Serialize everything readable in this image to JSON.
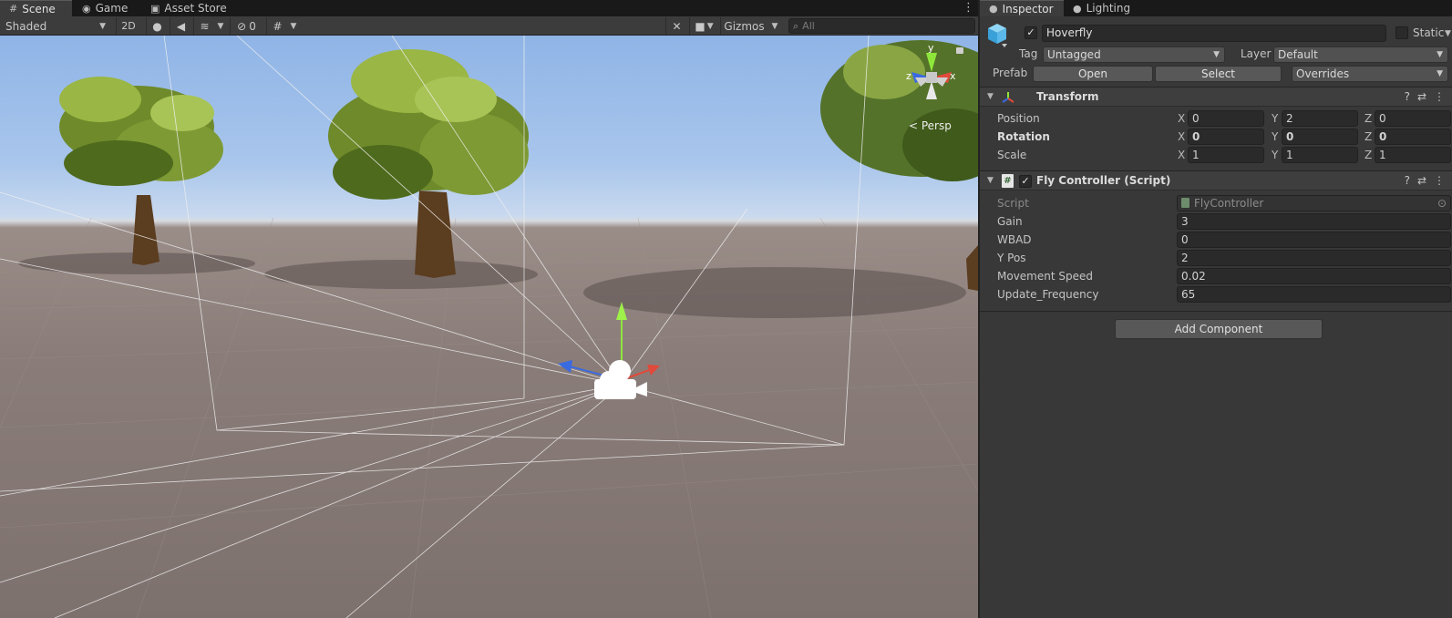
{
  "scene_tabs": [
    {
      "label": "Scene",
      "icon": "grid-icon",
      "active": true
    },
    {
      "label": "Game",
      "icon": "gamepad-icon",
      "active": false
    },
    {
      "label": "Asset Store",
      "icon": "store-bag-icon",
      "active": false
    }
  ],
  "toolbar": {
    "shading_mode": "Shaded",
    "mode_2d": "2D",
    "hidden_count": "0",
    "gizmos_label": "Gizmos",
    "search_placeholder": "All"
  },
  "viewport": {
    "axis_y": "y",
    "axis_x": "x",
    "axis_z": "z",
    "projection_label": "< Persp",
    "colors": {
      "sky_top": "#8fb4e6",
      "ground": "#8a7d79",
      "frustum_lines": "#e6e6e6",
      "axis_x": "#e04a3a",
      "axis_y": "#8ee63a",
      "axis_z": "#3a6ae0"
    }
  },
  "inspector_tabs": [
    {
      "label": "Inspector",
      "icon": "info-icon",
      "active": true
    },
    {
      "label": "Lighting",
      "icon": "lightbulb-icon",
      "active": false
    }
  ],
  "object": {
    "name": "Hoverfly",
    "active": true,
    "static_label": "Static",
    "static_checked": false,
    "tag_label": "Tag",
    "tag_value": "Untagged",
    "layer_label": "Layer",
    "layer_value": "Default",
    "prefab_label": "Prefab",
    "open_label": "Open",
    "select_label": "Select",
    "overrides_label": "Overrides"
  },
  "transform": {
    "title": "Transform",
    "rows": [
      {
        "label": "Position",
        "x": "0",
        "y": "2",
        "z": "0",
        "bold": false
      },
      {
        "label": "Rotation",
        "x": "0",
        "y": "0",
        "z": "0",
        "bold": true
      },
      {
        "label": "Scale",
        "x": "1",
        "y": "1",
        "z": "1",
        "bold": false
      }
    ]
  },
  "fly_controller": {
    "title": "Fly Controller (Script)",
    "enabled": true,
    "script_label": "Script",
    "script_value": "FlyController",
    "fields": [
      {
        "label": "Gain",
        "value": "3"
      },
      {
        "label": "WBAD",
        "value": "0"
      },
      {
        "label": "Y Pos",
        "value": "2"
      },
      {
        "label": "Movement Speed",
        "value": "0.02"
      },
      {
        "label": "Update_Frequency",
        "value": "65"
      }
    ]
  },
  "add_component_label": "Add Component",
  "colors": {
    "accent_cube": "#5ab8ea",
    "panel_bg": "#383838",
    "field_bg": "#2a2a2a"
  }
}
